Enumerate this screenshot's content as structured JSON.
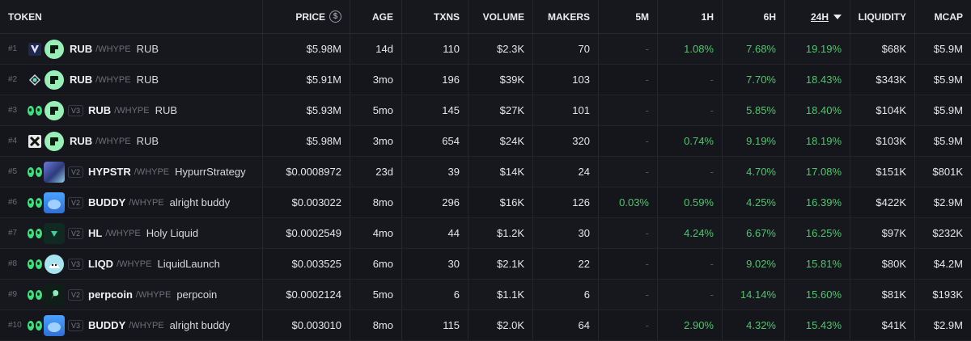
{
  "header": {
    "token": "TOKEN",
    "price": "PRICE",
    "price_icon": "$",
    "age": "AGE",
    "txns": "TXNS",
    "volume": "VOLUME",
    "makers": "MAKERS",
    "m5": "5M",
    "h1": "1H",
    "h6": "6H",
    "h24": "24H",
    "liquidity": "LIQUIDITY",
    "mcap": "MCAP"
  },
  "colors": {
    "positive": "#4fc46e",
    "dex_logo": "#99f0b6",
    "eyes": "#3ee07d"
  },
  "rows": [
    {
      "rank": "#1",
      "chain_icon": "v-chevron-icon",
      "dex_icon": "dex-logo",
      "version": "",
      "symbol": "RUB",
      "quote": "/WHYPE",
      "name": "RUB",
      "price": "$5.98M",
      "age": "14d",
      "txns": "110",
      "volume": "$2.3K",
      "makers": "70",
      "m5": "-",
      "h1": "1.08%",
      "h6": "7.68%",
      "h24": "19.19%",
      "liquidity": "$68K",
      "mcap": "$5.9M"
    },
    {
      "rank": "#2",
      "chain_icon": "swirl-icon",
      "dex_icon": "dex-logo",
      "version": "",
      "symbol": "RUB",
      "quote": "/WHYPE",
      "name": "RUB",
      "price": "$5.91M",
      "age": "3mo",
      "txns": "196",
      "volume": "$39K",
      "makers": "103",
      "m5": "-",
      "h1": "-",
      "h6": "7.70%",
      "h24": "18.43%",
      "liquidity": "$343K",
      "mcap": "$5.9M"
    },
    {
      "rank": "#3",
      "chain_icon": "eyes-icon",
      "dex_icon": "dex-logo",
      "version": "V3",
      "symbol": "RUB",
      "quote": "/WHYPE",
      "name": "RUB",
      "price": "$5.93M",
      "age": "5mo",
      "txns": "145",
      "volume": "$27K",
      "makers": "101",
      "m5": "-",
      "h1": "-",
      "h6": "5.85%",
      "h24": "18.40%",
      "liquidity": "$104K",
      "mcap": "$5.9M"
    },
    {
      "rank": "#4",
      "chain_icon": "x-cross-icon",
      "dex_icon": "dex-logo",
      "version": "",
      "symbol": "RUB",
      "quote": "/WHYPE",
      "name": "RUB",
      "price": "$5.98M",
      "age": "3mo",
      "txns": "654",
      "volume": "$24K",
      "makers": "320",
      "m5": "-",
      "h1": "0.74%",
      "h6": "9.19%",
      "h24": "18.19%",
      "liquidity": "$103K",
      "mcap": "$5.9M"
    },
    {
      "rank": "#5",
      "chain_icon": "eyes-icon",
      "dex_icon": "hypstr-logo",
      "version": "V2",
      "symbol": "HYPSTR",
      "quote": "/WHYPE",
      "name": "HypurrStrategy",
      "price": "$0.0008972",
      "age": "23d",
      "txns": "39",
      "volume": "$14K",
      "makers": "24",
      "m5": "-",
      "h1": "-",
      "h6": "4.70%",
      "h24": "17.08%",
      "liquidity": "$151K",
      "mcap": "$801K"
    },
    {
      "rank": "#6",
      "chain_icon": "eyes-icon",
      "dex_icon": "buddy-logo",
      "version": "V2",
      "symbol": "BUDDY",
      "quote": "/WHYPE",
      "name": "alright buddy",
      "price": "$0.003022",
      "age": "8mo",
      "txns": "296",
      "volume": "$16K",
      "makers": "126",
      "m5": "0.03%",
      "h1": "0.59%",
      "h6": "4.25%",
      "h24": "16.39%",
      "liquidity": "$422K",
      "mcap": "$2.9M"
    },
    {
      "rank": "#7",
      "chain_icon": "eyes-icon",
      "dex_icon": "hl-logo",
      "version": "V2",
      "symbol": "HL",
      "quote": "/WHYPE",
      "name": "Holy Liquid",
      "price": "$0.0002549",
      "age": "4mo",
      "txns": "44",
      "volume": "$1.2K",
      "makers": "30",
      "m5": "-",
      "h1": "4.24%",
      "h6": "6.67%",
      "h24": "16.25%",
      "liquidity": "$97K",
      "mcap": "$232K"
    },
    {
      "rank": "#8",
      "chain_icon": "eyes-icon",
      "dex_icon": "liqd-logo",
      "version": "V3",
      "symbol": "LIQD",
      "quote": "/WHYPE",
      "name": "LiquidLaunch",
      "price": "$0.003525",
      "age": "6mo",
      "txns": "30",
      "volume": "$2.1K",
      "makers": "22",
      "m5": "-",
      "h1": "-",
      "h6": "9.02%",
      "h24": "15.81%",
      "liquidity": "$80K",
      "mcap": "$4.2M"
    },
    {
      "rank": "#9",
      "chain_icon": "eyes-icon",
      "dex_icon": "perp-logo",
      "version": "V2",
      "symbol": "perpcoin",
      "quote": "/WHYPE",
      "name": "perpcoin",
      "price": "$0.0002124",
      "age": "5mo",
      "txns": "6",
      "volume": "$1.1K",
      "makers": "6",
      "m5": "-",
      "h1": "-",
      "h6": "14.14%",
      "h24": "15.60%",
      "liquidity": "$81K",
      "mcap": "$193K"
    },
    {
      "rank": "#10",
      "chain_icon": "eyes-icon",
      "dex_icon": "buddy-logo",
      "version": "V3",
      "symbol": "BUDDY",
      "quote": "/WHYPE",
      "name": "alright buddy",
      "price": "$0.003010",
      "age": "8mo",
      "txns": "115",
      "volume": "$2.0K",
      "makers": "64",
      "m5": "-",
      "h1": "2.90%",
      "h6": "4.32%",
      "h24": "15.43%",
      "liquidity": "$41K",
      "mcap": "$2.9M"
    }
  ]
}
